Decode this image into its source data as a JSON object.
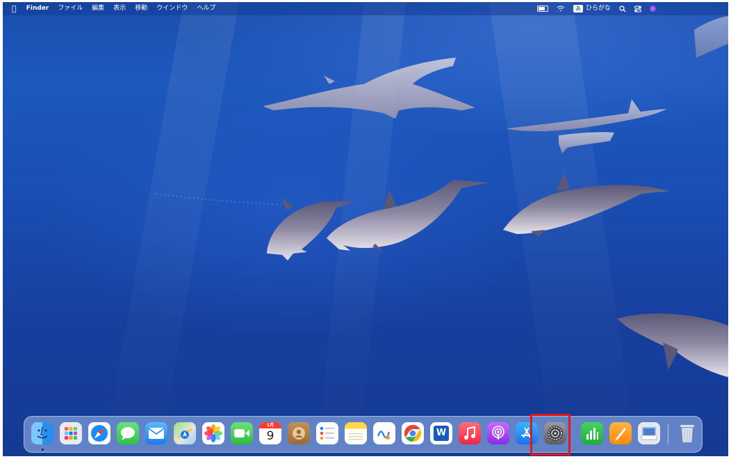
{
  "menubar": {
    "apple_icon": "apple-icon",
    "app_name": "Finder",
    "menus": [
      "ファイル",
      "編集",
      "表示",
      "移動",
      "ウインドウ",
      "ヘルプ"
    ],
    "input_mode_badge": "あ",
    "input_mode_label": "ひらがな",
    "status_icons": [
      "battery-icon",
      "wifi-icon",
      "search-icon",
      "control-center-icon",
      "siri-icon"
    ]
  },
  "dock": {
    "apps": [
      {
        "name": "Finder",
        "icon": "finder-icon"
      },
      {
        "name": "Launchpad",
        "icon": "launchpad-icon"
      },
      {
        "name": "Safari",
        "icon": "safari-icon"
      },
      {
        "name": "メッセージ",
        "icon": "messages-icon"
      },
      {
        "name": "メール",
        "icon": "mail-icon"
      },
      {
        "name": "マップ",
        "icon": "maps-icon"
      },
      {
        "name": "写真",
        "icon": "photos-icon"
      },
      {
        "name": "FaceTime",
        "icon": "facetime-icon"
      },
      {
        "name": "カレンダー",
        "icon": "calendar-icon",
        "month": "1月",
        "day": "9"
      },
      {
        "name": "連絡先",
        "icon": "contacts-icon"
      },
      {
        "name": "リマインダー",
        "icon": "reminders-icon"
      },
      {
        "name": "メモ",
        "icon": "notes-icon"
      },
      {
        "name": "フリーボード",
        "icon": "freeform-icon"
      },
      {
        "name": "Google Chrome",
        "icon": "chrome-icon"
      },
      {
        "name": "Microsoft Word",
        "icon": "word-icon",
        "letter": "W"
      },
      {
        "name": "ミュージック",
        "icon": "music-icon"
      },
      {
        "name": "Podcast",
        "icon": "podcasts-icon"
      },
      {
        "name": "App Store",
        "icon": "app-store-icon"
      },
      {
        "name": "システム設定",
        "icon": "system-settings-icon"
      },
      {
        "name": "Numbers",
        "icon": "numbers-icon"
      },
      {
        "name": "Pages",
        "icon": "pages-icon"
      },
      {
        "name": "プレビュー",
        "icon": "preview-icon"
      }
    ],
    "trash": {
      "name": "ゴミ箱",
      "icon": "trash-icon"
    },
    "highlight_color": "#e8141c"
  },
  "wallpaper": {
    "subject": "dolphins-underwater",
    "base_color": "#1a4fae"
  }
}
